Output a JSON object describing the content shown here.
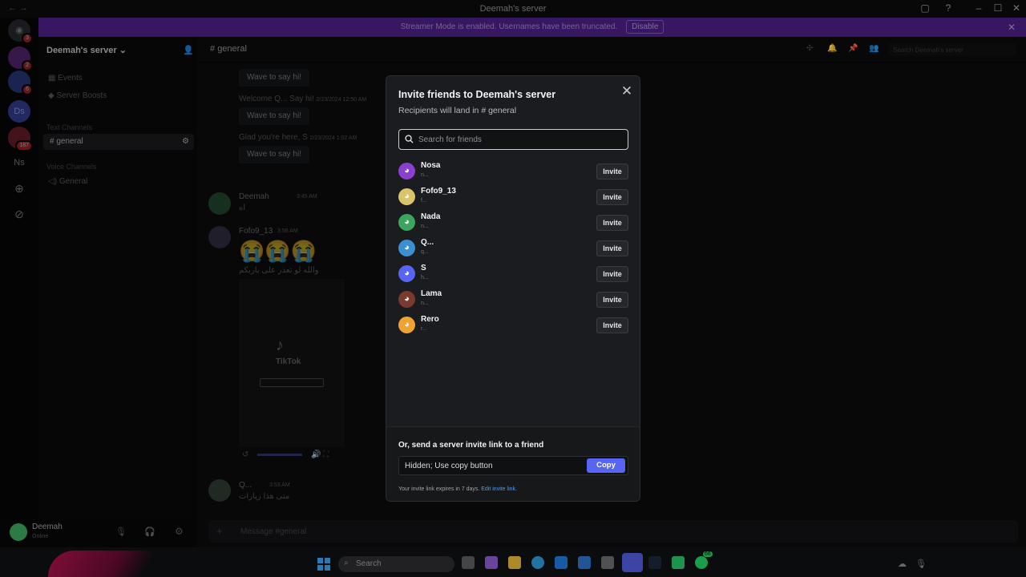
{
  "window": {
    "title": "Deemah's server"
  },
  "banner": {
    "text": "Streamer Mode is enabled. Usernames have been truncated.",
    "disable_label": "Disable"
  },
  "guilds": [
    {
      "label": "",
      "badge": "3"
    },
    {
      "label": "",
      "badge": "2"
    },
    {
      "label": "",
      "badge": "6"
    },
    {
      "label": "Ds",
      "badge": ""
    },
    {
      "label": "",
      "badge": "187"
    },
    {
      "label": "Ns",
      "badge": ""
    }
  ],
  "sidebar": {
    "server_name": "Deemah's server",
    "items": [
      "Events",
      "Server Boosts"
    ],
    "text_category": "Text Channels",
    "text_channel": "general",
    "voice_category": "Voice Channels",
    "voice_channel": "General"
  },
  "user": {
    "name": "Deemah",
    "status": "Online"
  },
  "chat": {
    "channel": "general",
    "search_placeholder": "Search Deemah's server",
    "wave": "Wave to say hi!",
    "welcome": "Welcome Q... Say hi!",
    "welcome_time": "2/23/2024 12:50 AM",
    "glad": "Glad you're here, S",
    "glad_time": "2/23/2024 1:02 AM",
    "msgs": [
      {
        "author": "Deemah",
        "time": "3:45 AM",
        "text": "اه"
      },
      {
        "author": "Fofo9_13",
        "time": "3:56 AM",
        "text": "والله لو تعذر على باربكم"
      },
      {
        "author": "Q...",
        "time": "3:53 AM",
        "text": "متى هذا زيارات"
      }
    ],
    "tiktok": "TikTok",
    "composer_placeholder": "Message #general"
  },
  "modal": {
    "title": "Invite friends to Deemah's server",
    "subtitle": "Recipients will land in",
    "channel": "general",
    "search_placeholder": "Search for friends",
    "invite_label": "Invite",
    "friends": [
      {
        "name": "Nosa",
        "sub": "n...",
        "color": "#8a3fd1"
      },
      {
        "name": "Fofo9_13",
        "sub": "f...",
        "color": "#d9c46a"
      },
      {
        "name": "Nada",
        "sub": "n...",
        "color": "#3ba55d"
      },
      {
        "name": "Q...",
        "sub": "q...",
        "color": "#3b8fd1"
      },
      {
        "name": "S",
        "sub": "h...",
        "color": "#5865f2"
      },
      {
        "name": "Lama",
        "sub": "n...",
        "color": "#7a3b2e"
      },
      {
        "name": "Rero",
        "sub": "r...",
        "color": "#f0a332"
      }
    ],
    "footer_label": "Or, send a server invite link to a friend",
    "link_value": "Hidden; Use copy button",
    "copy_label": "Copy",
    "expiry": "Your invite link expires in 7 days.",
    "edit_link": "Edit invite link."
  },
  "taskbar": {
    "search": "Search",
    "whatsapp_badge": "66"
  }
}
